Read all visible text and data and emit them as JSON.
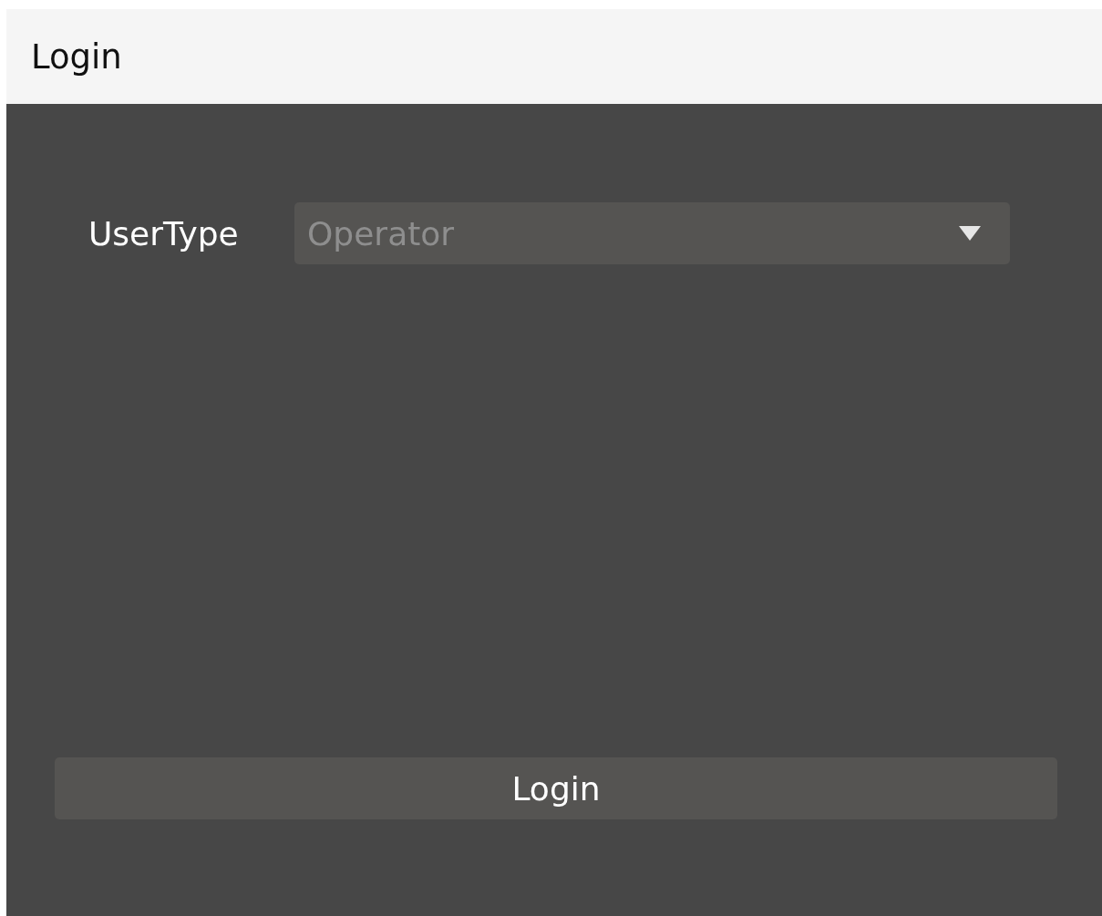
{
  "window": {
    "title": "Login"
  },
  "user_type": {
    "label": "UserType",
    "value": "Operator"
  },
  "buttons": [
    "Login"
  ]
}
